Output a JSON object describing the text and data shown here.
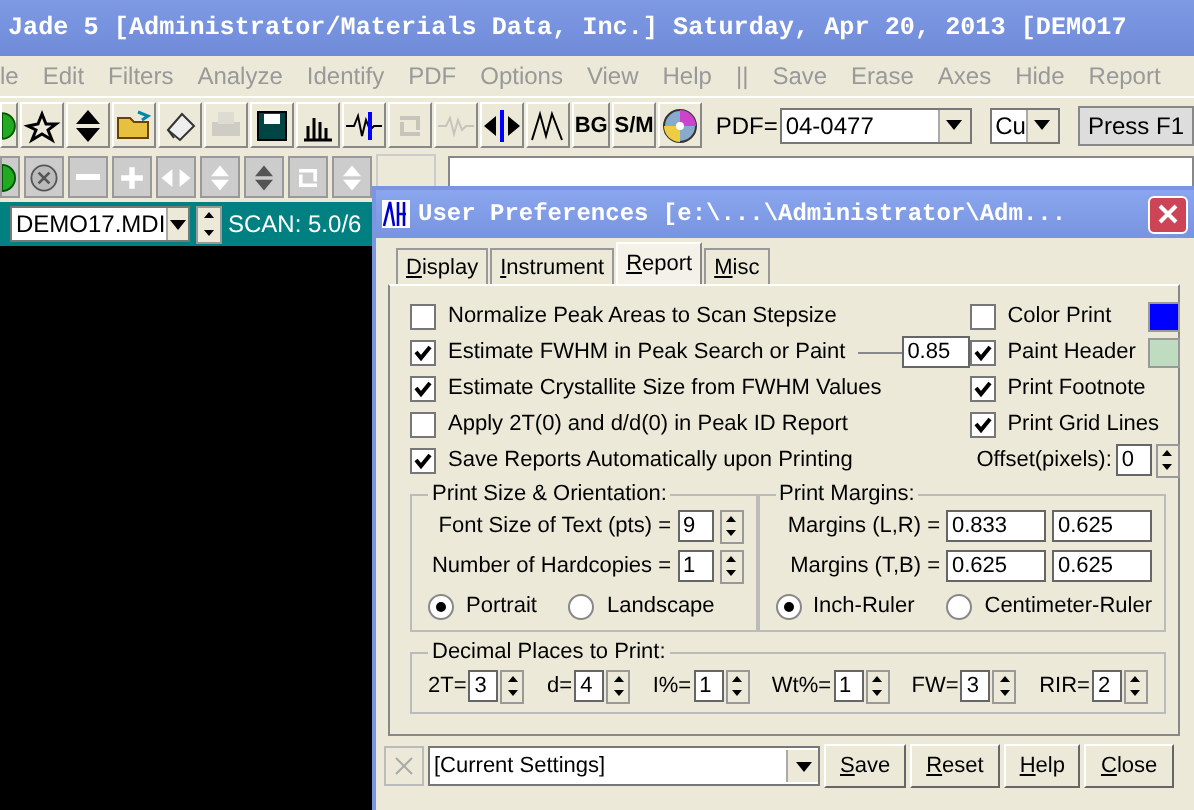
{
  "app": {
    "title": "Jade 5 [Administrator/Materials Data, Inc.] Saturday, Apr 20, 2013 [DEMO17",
    "menu": [
      "le",
      "Edit",
      "Filters",
      "Analyze",
      "Identify",
      "PDF",
      "Options",
      "View",
      "Help",
      "||",
      "Save",
      "Erase",
      "Axes",
      "Hide",
      "Report"
    ],
    "toolbar": [
      {
        "kind": "icon",
        "disabled": false
      },
      {
        "kind": "icon",
        "disabled": false
      },
      {
        "kind": "icon",
        "disabled": false
      },
      {
        "kind": "icon",
        "disabled": false
      },
      {
        "kind": "icon",
        "disabled": false
      },
      {
        "kind": "icon",
        "disabled": true
      },
      {
        "kind": "icon",
        "disabled": false
      },
      {
        "kind": "icon",
        "disabled": false
      },
      {
        "kind": "icon",
        "disabled": false
      },
      {
        "kind": "icon",
        "disabled": true
      },
      {
        "kind": "icon",
        "disabled": true
      },
      {
        "kind": "icon",
        "disabled": false
      },
      {
        "kind": "icon",
        "disabled": false
      },
      {
        "kind": "text",
        "label": "BG"
      },
      {
        "kind": "text",
        "label": "S/M"
      },
      {
        "kind": "icon",
        "disabled": false
      }
    ],
    "pdf_label": "PDF=",
    "pdf_value": "04-0477",
    "anode": "Cu",
    "help_button": "Press F1",
    "file": "DEMO17.MDI",
    "scan": "SCAN: 5.0/6"
  },
  "dialog": {
    "title": "User Preferences [e:\\...\\Administrator\\Adm...",
    "tabs": [
      {
        "label": "Display",
        "selected": false
      },
      {
        "label": "Instrument",
        "selected": false
      },
      {
        "label": "Report",
        "selected": true
      },
      {
        "label": "Misc",
        "selected": false
      }
    ],
    "options": [
      {
        "label": "Normalize Peak Areas to Scan Stepsize",
        "checked": false
      },
      {
        "label": "Estimate FWHM in Peak Search or Paint",
        "checked": true,
        "value": "0.85"
      },
      {
        "label": "Estimate Crystallite Size from FWHM Values",
        "checked": true
      },
      {
        "label": "Apply 2T(0) and d/d(0) in Peak ID Report",
        "checked": false
      },
      {
        "label": "Save Reports Automatically upon Printing",
        "checked": true
      }
    ],
    "print_options": [
      {
        "label": "Color Print",
        "checked": false,
        "color": "#0000ff"
      },
      {
        "label": "Paint Header",
        "checked": true,
        "color": "#c0dcc0"
      },
      {
        "label": "Print Footnote",
        "checked": true
      },
      {
        "label": "Print Grid Lines",
        "checked": true
      }
    ],
    "offset": {
      "label": "Offset(pixels):",
      "value": "0"
    },
    "print_size": {
      "title": "Print Size & Orientation:",
      "fields": [
        {
          "label": "Font Size of Text (pts) =",
          "value": "9"
        },
        {
          "label": "Number of Hardcopies =",
          "value": "1"
        }
      ],
      "orientation": [
        {
          "label": "Portrait",
          "selected": true
        },
        {
          "label": "Landscape",
          "selected": false
        }
      ]
    },
    "print_margins": {
      "title": "Print Margins:",
      "rows": [
        {
          "label": "Margins (L,R) =",
          "values": [
            "0.833",
            "0.625"
          ]
        },
        {
          "label": "Margins (T,B) =",
          "values": [
            "0.625",
            "0.625"
          ]
        }
      ],
      "ruler": [
        {
          "label": "Inch-Ruler",
          "selected": true
        },
        {
          "label": "Centimeter-Ruler",
          "selected": false
        }
      ]
    },
    "decimal_places": {
      "title": "Decimal Places to Print:",
      "fields": [
        {
          "label": "2T=",
          "value": "3"
        },
        {
          "label": "d=",
          "value": "4"
        },
        {
          "label": "I%=",
          "value": "1"
        },
        {
          "label": "Wt%=",
          "value": "1"
        },
        {
          "label": "FW=",
          "value": "3"
        },
        {
          "label": "RIR=",
          "value": "2"
        }
      ]
    },
    "footer": {
      "preset": "[Current Settings]",
      "buttons": [
        "Save",
        "Reset",
        "Help",
        "Close"
      ]
    }
  }
}
